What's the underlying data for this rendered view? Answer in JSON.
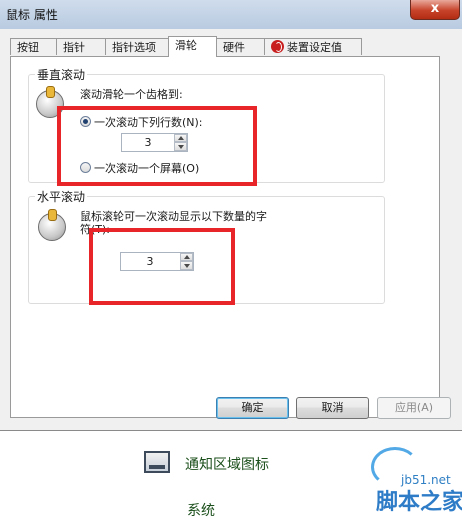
{
  "window": {
    "title": "鼠标 属性",
    "close_glyph": "x"
  },
  "tabs": [
    {
      "label": "按钮"
    },
    {
      "label": "指针"
    },
    {
      "label": "指针选项"
    },
    {
      "label": "滑轮"
    },
    {
      "label": "硬件"
    },
    {
      "label": "装置设定值"
    }
  ],
  "vertical": {
    "group_label": "垂直滚动",
    "instruction": "滚动滑轮一个齿格到:",
    "option_lines": "一次滚动下列行数(N):",
    "lines_value": "3",
    "option_screen": "一次滚动一个屏幕(O)"
  },
  "horizontal": {
    "group_label": "水平滚动",
    "instruction_line1": "鼠标滚轮可一次滚动显示以下数量的字",
    "instruction_line2": "符(T):",
    "chars_value": "3"
  },
  "buttons": {
    "ok": "确定",
    "cancel": "取消",
    "apply": "应用(A)"
  },
  "background": {
    "item1": "通知区域图标",
    "item2": "系统"
  },
  "watermark": {
    "domain": "jb51.net",
    "name": "脚本之家"
  }
}
